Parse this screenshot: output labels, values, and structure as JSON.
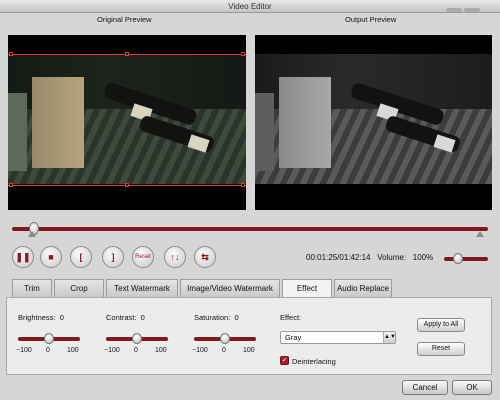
{
  "window": {
    "title": "Video Editor"
  },
  "preview": {
    "original_label": "Original Preview",
    "output_label": "Output Preview"
  },
  "playback": {
    "progress": 0.012,
    "buttons": [
      {
        "name": "pause-button",
        "glyph": "❚❚"
      },
      {
        "name": "stop-button",
        "glyph": "■"
      },
      {
        "name": "mark-in-button",
        "glyph": "["
      },
      {
        "name": "mark-out-button",
        "glyph": "]"
      },
      {
        "name": "reset-playback-button",
        "glyph": "Reset"
      },
      {
        "name": "flip-vertical-button",
        "glyph": "↑↓"
      },
      {
        "name": "flip-horizontal-button",
        "glyph": "⇆"
      }
    ],
    "timecode": "00:01:25/01:42:14",
    "volume_label": "Volume:",
    "volume_value": "100%",
    "volume_level": 0.25
  },
  "tabs": [
    {
      "label": "Trim",
      "active": false
    },
    {
      "label": "Crop",
      "active": false
    },
    {
      "label": "Text Watermark",
      "active": false
    },
    {
      "label": "Image/Video Watermark",
      "active": false
    },
    {
      "label": "Effect",
      "active": true
    },
    {
      "label": "Audio Replace",
      "active": false
    }
  ],
  "effect_panel": {
    "brightness": {
      "label": "Brightness:",
      "value": "0",
      "min": "−100",
      "mid": "0",
      "max": "100",
      "level": 0.5
    },
    "contrast": {
      "label": "Contrast:",
      "value": "0",
      "min": "−100",
      "mid": "0",
      "max": "100",
      "level": 0.5
    },
    "saturation": {
      "label": "Saturation:",
      "value": "0",
      "min": "−100",
      "mid": "0",
      "max": "100",
      "level": 0.5
    },
    "effect_label": "Effect:",
    "effect_value": "Gray",
    "deinterlacing_label": "Deinterlacing",
    "deinterlacing_checked": true,
    "apply_to_all_label": "Apply to All",
    "reset_label": "Reset"
  },
  "footer": {
    "cancel_label": "Cancel",
    "ok_label": "OK"
  }
}
